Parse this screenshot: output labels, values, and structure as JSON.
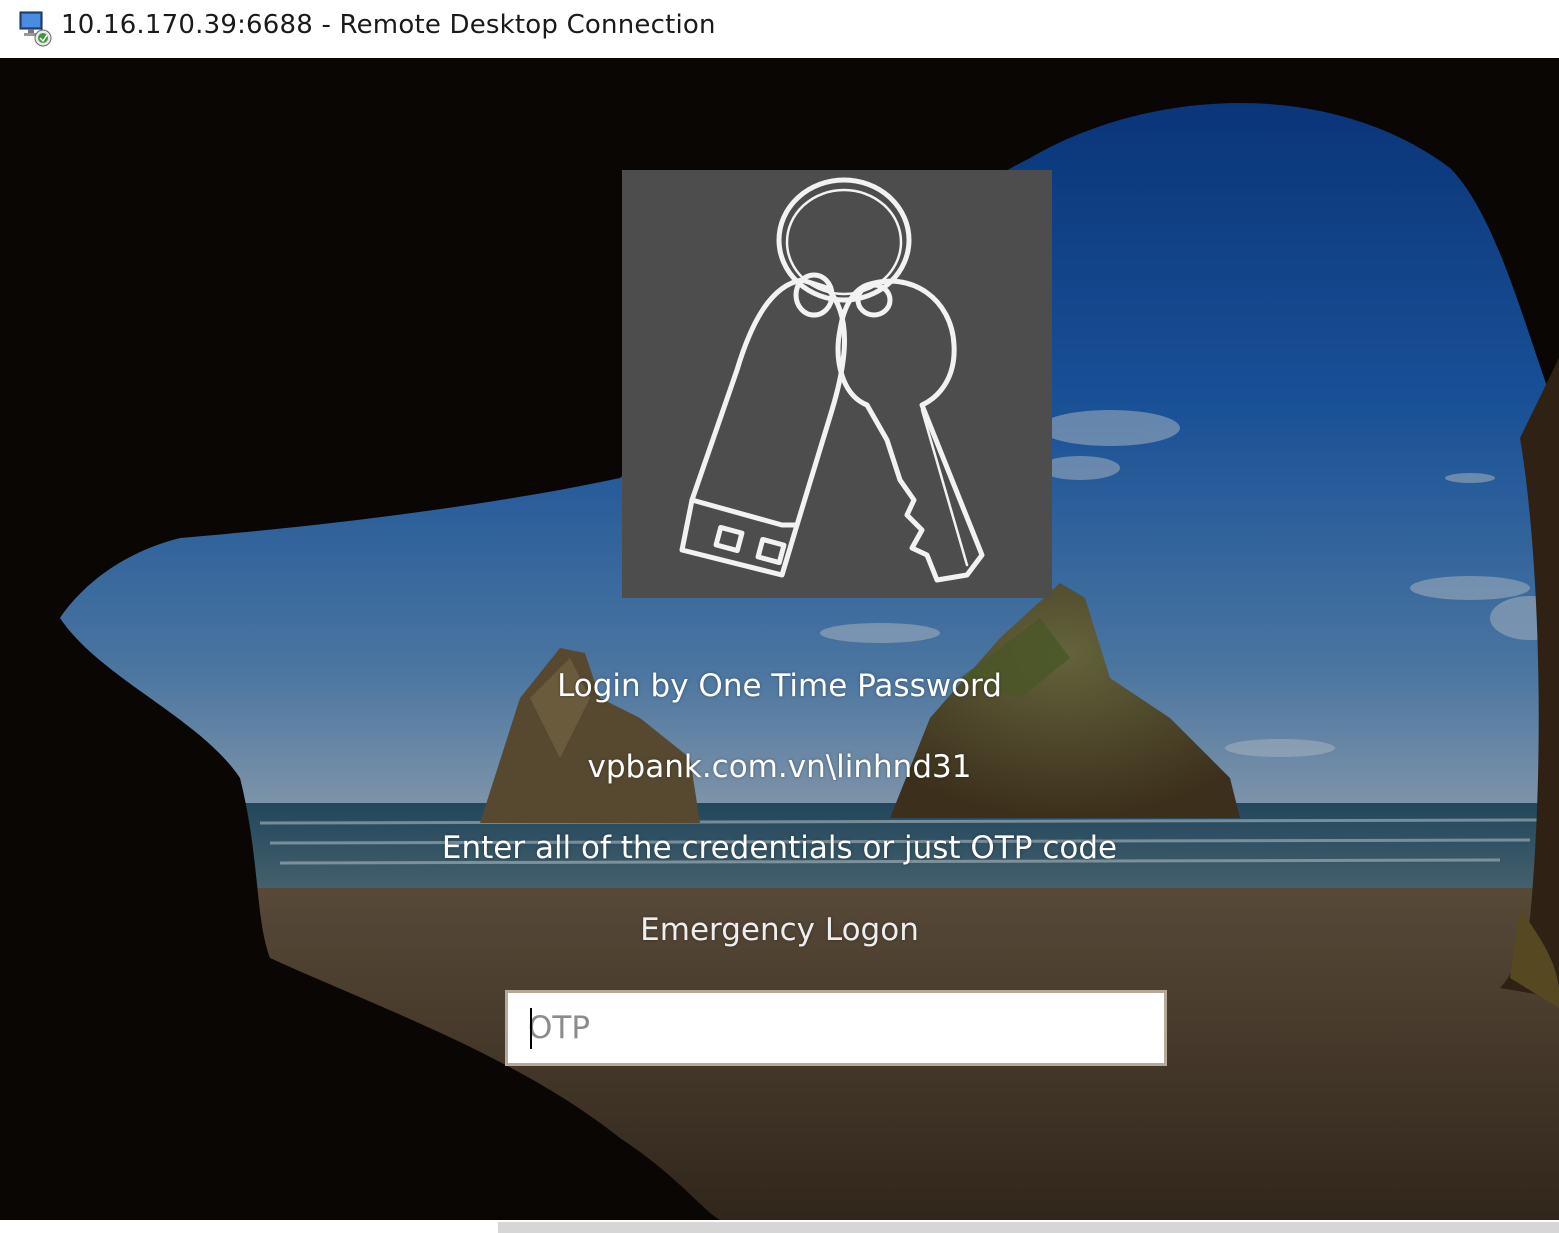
{
  "window": {
    "title": "10.16.170.39:6688 - Remote Desktop Connection",
    "icon": "remote-desktop-icon"
  },
  "logon": {
    "tile_icon": "keys-usb-keyring-icon",
    "heading": "Login by One Time Password",
    "user": "vpbank.com.vn\\linhnd31",
    "instruction": "Enter all of the credentials or just OTP code",
    "emergency_link": "Emergency Logon",
    "otp": {
      "value": "",
      "placeholder": "OTP"
    }
  },
  "colors": {
    "tile_background": "#4d4d4d",
    "text": "#ffffff",
    "field_border": "#b5a99a"
  }
}
